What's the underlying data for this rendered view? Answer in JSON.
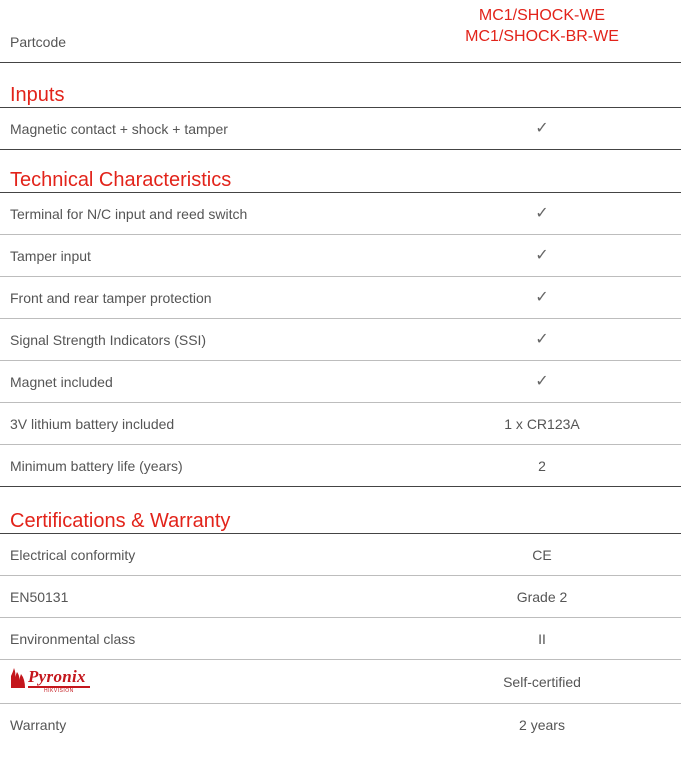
{
  "header": {
    "partcode_label": "Partcode",
    "codes": [
      "MC1/SHOCK-WE",
      "MC1/SHOCK-BR-WE"
    ]
  },
  "sections": {
    "inputs": {
      "title": "Inputs",
      "rows": [
        {
          "label": "Magnetic contact + shock + tamper",
          "value": "✓"
        }
      ]
    },
    "technical": {
      "title": "Technical Characteristics",
      "rows": [
        {
          "label": "Terminal for N/C input and reed switch",
          "value": "✓"
        },
        {
          "label": "Tamper input",
          "value": "✓"
        },
        {
          "label": "Front and rear tamper protection",
          "value": "✓"
        },
        {
          "label": "Signal Strength Indicators (SSI)",
          "value": "✓"
        },
        {
          "label": "Magnet included",
          "value": "✓"
        },
        {
          "label": "3V lithium battery included",
          "value": "1 x CR123A"
        },
        {
          "label": "Minimum battery life (years)",
          "value": "2"
        }
      ]
    },
    "certifications": {
      "title": "Certifications & Warranty",
      "rows": [
        {
          "label": "Electrical conformity",
          "value": "CE"
        },
        {
          "label": "EN50131",
          "value": "Grade 2"
        },
        {
          "label": "Environmental class",
          "value": "II"
        },
        {
          "label": "",
          "logo": {
            "brand": "Pyronix",
            "sub": "HIKVISION"
          },
          "value": "Self-certified"
        },
        {
          "label": "Warranty",
          "value": "2 years"
        }
      ]
    }
  },
  "colors": {
    "accent": "#e2231a",
    "text": "#555555",
    "divider": "#bdbdbd",
    "rule": "#444444"
  }
}
